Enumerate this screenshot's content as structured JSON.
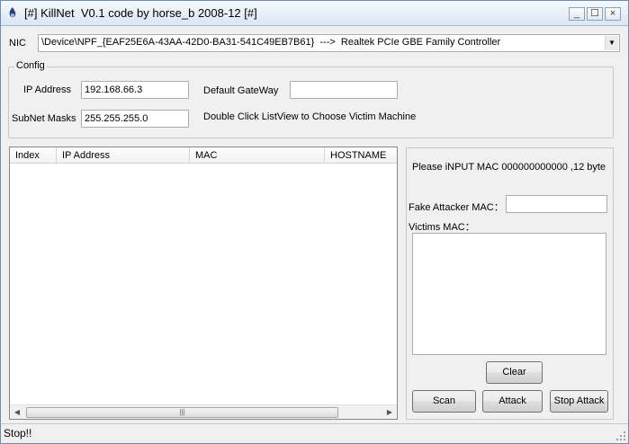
{
  "window": {
    "title": "[#] KillNet  V0.1 code by horse_b 2008-12 [#]",
    "minimize_glyph": "_",
    "maximize_glyph": "☐",
    "close_glyph": "×",
    "app_icon": "killnet-app-icon"
  },
  "nic": {
    "label": "NIC",
    "selected": "\\Device\\NPF_{EAF25E6A-43AA-42D0-BA31-541C49EB7B61}  --->  Realtek PCIe GBE Family Controller"
  },
  "config": {
    "title": "Config",
    "ip_label": "IP Address",
    "ip_value": "192.168.66.3",
    "gateway_label": "Default GateWay",
    "gateway_value": "",
    "mask_label": "SubNet Masks",
    "mask_value": "255.255.255.0",
    "hint": "Double Click ListView to Choose Victim Machine"
  },
  "listview": {
    "columns": [
      "Index",
      "IP Address",
      "MAC",
      "HOSTNAME"
    ],
    "rows": []
  },
  "attack_panel": {
    "instruction": "Please iNPUT MAC 000000000000 ,12 byte",
    "fake_mac_label": "Fake Attacker MAC：",
    "fake_mac_value": "",
    "victims_label": "Victims MAC：",
    "victims_value": "",
    "clear_label": "Clear",
    "scan_label": "Scan",
    "attack_label": "Attack",
    "stop_label": "Stop Attack"
  },
  "status": {
    "text": "Stop!!"
  }
}
